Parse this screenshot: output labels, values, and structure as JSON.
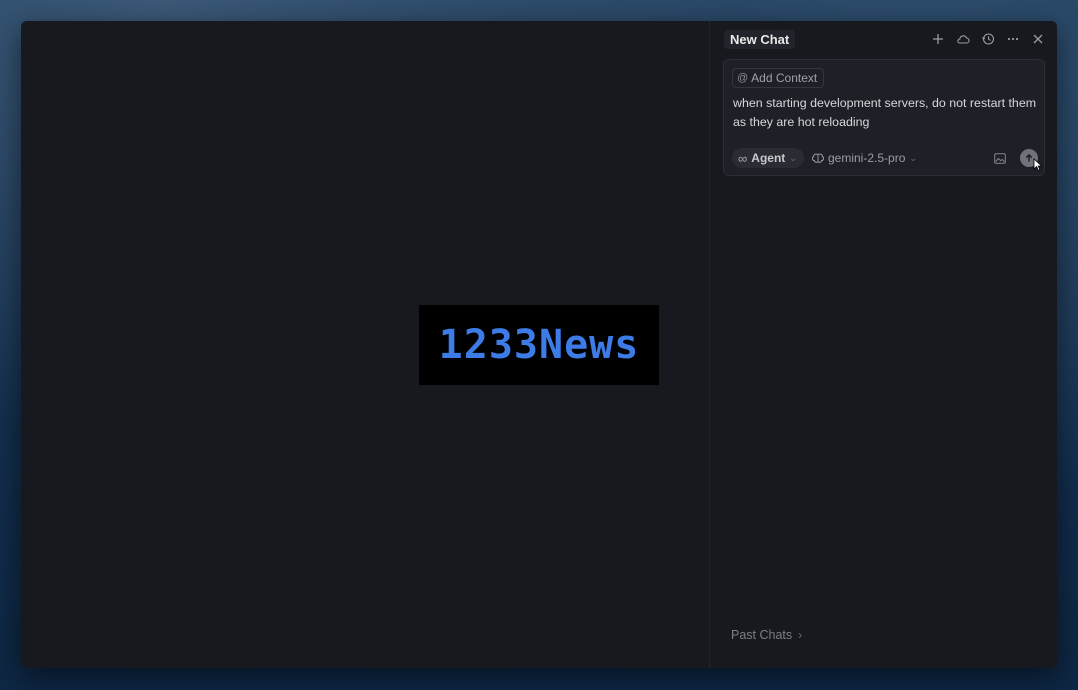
{
  "editor": {
    "logo_text": "1233News",
    "logo_color": "#3d7be6"
  },
  "chat": {
    "title": "New Chat",
    "header_icons": [
      "plus-icon",
      "cloud-icon",
      "history-icon",
      "more-icon",
      "close-icon"
    ],
    "add_context_label": "Add Context",
    "prompt_text": "when starting development servers, do not restart them as they are hot reloading",
    "mode_label": "Agent",
    "model_label": "gemini-2.5-pro",
    "past_chats_label": "Past Chats"
  }
}
